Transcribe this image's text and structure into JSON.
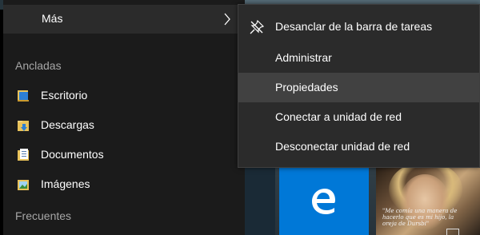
{
  "start_menu": {
    "more_item": {
      "label": "Más",
      "icon": "chevron-right-icon"
    },
    "pinned_section": {
      "title": "Ancladas",
      "items": [
        {
          "label": "Escritorio",
          "icon": "desktop-folder-icon"
        },
        {
          "label": "Descargas",
          "icon": "downloads-folder-icon"
        },
        {
          "label": "Documentos",
          "icon": "documents-folder-icon"
        },
        {
          "label": "Imágenes",
          "icon": "pictures-folder-icon"
        }
      ]
    },
    "frequent_section": {
      "title": "Frecuentes"
    }
  },
  "context_menu": {
    "items": [
      {
        "label": "Desanclar de la barra de tareas",
        "icon": "unpin-icon"
      },
      {
        "label": "Administrar"
      },
      {
        "label": "Propiedades",
        "highlighted": true
      },
      {
        "label": "Conectar a unidad de red"
      },
      {
        "label": "Desconectar unidad de red"
      }
    ]
  },
  "tiles": {
    "edge": {
      "icon": "edge-icon",
      "color": "#0078d7"
    },
    "photo": {
      "caption": "\"Me comía una manera de hacerlo que es mi hijo, la oreja de Dursbi\""
    }
  },
  "colors": {
    "menu_bg": "#2b2b2b",
    "highlight": "#414141",
    "pane_bg": "#1b1b1b",
    "accent": "#0078d7"
  }
}
